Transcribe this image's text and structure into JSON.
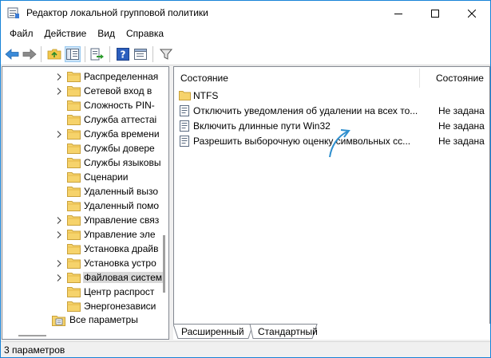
{
  "window": {
    "title": "Редактор локальной групповой политики"
  },
  "menu": {
    "file": "Файл",
    "action": "Действие",
    "view": "Вид",
    "help": "Справка"
  },
  "tree": {
    "items": [
      {
        "label": "Распределенная",
        "expandable": true
      },
      {
        "label": "Сетевой вход в",
        "expandable": true
      },
      {
        "label": "Сложность PIN-",
        "expandable": false
      },
      {
        "label": "Служба аттестаі",
        "expandable": false
      },
      {
        "label": "Служба времени",
        "expandable": true
      },
      {
        "label": "Службы довере",
        "expandable": false
      },
      {
        "label": "Службы языковы",
        "expandable": false
      },
      {
        "label": "Сценарии",
        "expandable": false
      },
      {
        "label": "Удаленный вызо",
        "expandable": false
      },
      {
        "label": "Удаленный помо",
        "expandable": false
      },
      {
        "label": "Управление связ",
        "expandable": true
      },
      {
        "label": "Управление эле",
        "expandable": true
      },
      {
        "label": "Установка драйв",
        "expandable": false
      },
      {
        "label": "Установка устро",
        "expandable": true
      },
      {
        "label": "Файловая систем",
        "expandable": true,
        "selected": true
      },
      {
        "label": "Центр распрост",
        "expandable": false
      },
      {
        "label": "Энергонезависи",
        "expandable": false
      }
    ],
    "root_item": "Все параметры"
  },
  "list": {
    "columns": {
      "name": "Состояние",
      "state": "Состояние"
    },
    "rows": [
      {
        "type": "folder",
        "name": "NTFS",
        "state": ""
      },
      {
        "type": "setting",
        "name": "Отключить уведомления об удалении на всех то...",
        "state": "Не задана"
      },
      {
        "type": "setting",
        "name": "Включить длинные пути Win32",
        "state": "Не задана"
      },
      {
        "type": "setting",
        "name": "Разрешить выборочную оценку символьных сс...",
        "state": "Не задана"
      }
    ]
  },
  "tabs": {
    "extended": "Расширенный",
    "standard": "Стандартный",
    "active": "standard"
  },
  "status": {
    "text": "3 параметров"
  },
  "colors": {
    "accent": "#1883d7",
    "folder": "#f6d36b",
    "arrow_annotation": "#2f8fce"
  }
}
